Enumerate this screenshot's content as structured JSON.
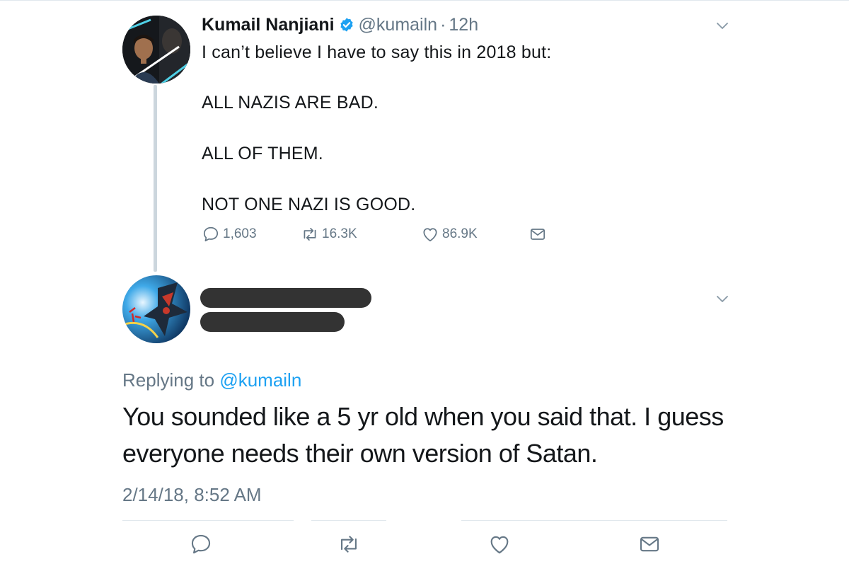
{
  "original_tweet": {
    "author_name": "Kumail Nanjiani",
    "handle": "@kumailn",
    "separator": "·",
    "time": "12h",
    "lines": [
      "I can’t believe I have to say this in 2018 but:",
      "ALL NAZIS ARE BAD.",
      "ALL OF THEM.",
      "NOT ONE NAZI IS GOOD."
    ],
    "replies": "1,603",
    "retweets": "16.3K",
    "likes": "86.9K",
    "icons": [
      "verified-badge-icon",
      "chevron-down-icon",
      "reply-icon",
      "retweet-icon",
      "like-icon",
      "message-icon"
    ]
  },
  "reply_tweet": {
    "replying_prefix": "Replying to",
    "replying_handle": "@kumailn",
    "text": "You sounded like a 5 yr old when you said that. I guess everyone needs their own version of Satan.",
    "timestamp": "2/14/18, 8:52 AM",
    "icons": [
      "chevron-down-icon",
      "reply-icon",
      "retweet-icon",
      "like-icon",
      "message-icon"
    ]
  },
  "colors": {
    "text_primary": "#14171a",
    "text_secondary": "#657786",
    "accent_blue": "#1da1f2",
    "thread_line": "#ccd6dd",
    "redaction": "#333333"
  }
}
